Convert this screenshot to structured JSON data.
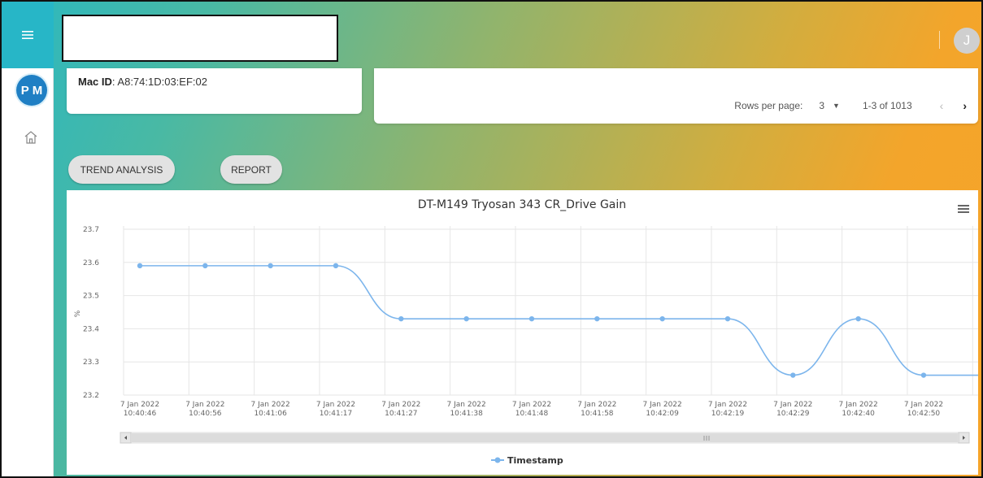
{
  "header": {
    "user_initial": "J"
  },
  "sidebar": {
    "avatar_initials": "P M",
    "menu_icon": "hamburger-icon",
    "home_icon": "home-icon"
  },
  "device": {
    "mac_label": "Mac ID",
    "mac_value": ": A8:74:1D:03:EF:02"
  },
  "pagination": {
    "rows_per_page_label": "Rows per page:",
    "rows_per_page_value": "3",
    "range_text": "1-3 of 1013"
  },
  "actions": {
    "trend_label": "TREND ANALYSIS",
    "report_label": "REPORT"
  },
  "colors": {
    "series": "#7cb5ec",
    "accent_teal": "#27b6c7",
    "accent_orange": "#f7a428",
    "avatar_blue": "#1f7fc4"
  },
  "chart_data": {
    "type": "line",
    "title": "DT-M149 Tryosan 343 CR_Drive Gain",
    "ylabel": "%",
    "xlabel": "",
    "ylim": [
      23.2,
      23.7
    ],
    "yticks": [
      "23.7",
      "23.6",
      "23.5",
      "23.4",
      "23.3",
      "23.2"
    ],
    "x": [
      "7 Jan 2022|10:40:46",
      "7 Jan 2022|10:40:56",
      "7 Jan 2022|10:41:06",
      "7 Jan 2022|10:41:17",
      "7 Jan 2022|10:41:27",
      "7 Jan 2022|10:41:38",
      "7 Jan 2022|10:41:48",
      "7 Jan 2022|10:41:58",
      "7 Jan 2022|10:42:09",
      "7 Jan 2022|10:42:19",
      "7 Jan 2022|10:42:29",
      "7 Jan 2022|10:42:40",
      "7 Jan 2022|10:42:50"
    ],
    "series": [
      {
        "name": "Timestamp",
        "values": [
          23.59,
          23.59,
          23.59,
          23.59,
          23.43,
          23.43,
          23.43,
          23.43,
          23.43,
          23.43,
          23.26,
          23.43,
          23.26
        ]
      }
    ],
    "grid": true,
    "legend": "bottom-center",
    "scrollbar": true
  }
}
